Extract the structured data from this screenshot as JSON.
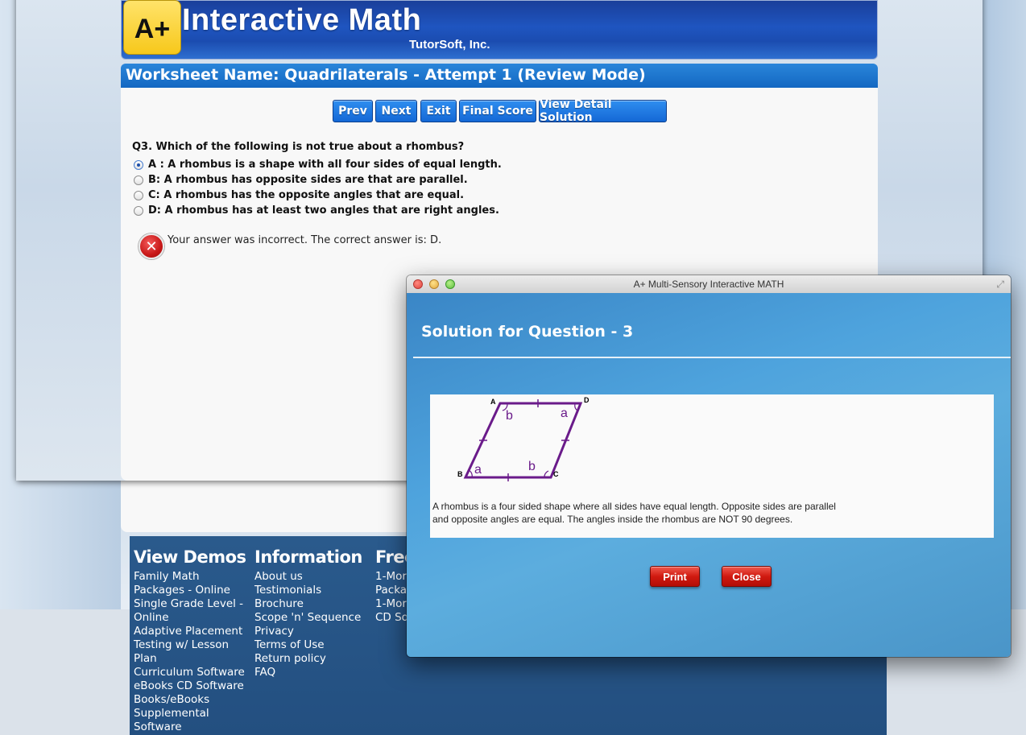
{
  "header": {
    "logo_text": "A+",
    "site_title": "Interactive Math",
    "company": "TutorSoft, Inc."
  },
  "worksheet": {
    "title": "Worksheet Name: Quadrilaterals - Attempt 1 (Review Mode)"
  },
  "nav_buttons": {
    "prev": "Prev",
    "next": "Next",
    "exit": "Exit",
    "final_score": "Final Score",
    "view_detail": "View Detail Solution"
  },
  "question": {
    "text": "Q3.  Which of the following is not true about a rhombus?",
    "options": [
      {
        "label": "A :  A rhombus is a shape with all four sides of equal length.",
        "selected": true
      },
      {
        "label": "B:  A rhombus has opposite sides are that are parallel.",
        "selected": false
      },
      {
        "label": "C:  A rhombus has the opposite angles that are equal.",
        "selected": false
      },
      {
        "label": "D:  A rhombus has at least two angles that are right angles.",
        "selected": false
      }
    ],
    "feedback": "Your answer was  incorrect.  The correct answer is: D."
  },
  "footer": {
    "columns": [
      {
        "heading": "View Demos",
        "links": [
          "Family Math",
          "Packages - Online",
          "Single Grade Level -",
          "Online",
          "Adaptive Placement",
          "Testing w/ Lesson",
          "Plan",
          "Curriculum Software",
          "eBooks CD Software",
          "Books/eBooks",
          "Supplemental",
          "Software"
        ]
      },
      {
        "heading": "Information",
        "links": [
          "About us",
          "Testimonials",
          "Brochure",
          "Scope 'n' Sequence",
          "Privacy",
          "Terms of Use",
          "Return policy",
          "FAQ"
        ]
      },
      {
        "heading": "Free",
        "links": [
          "1-Mor",
          "Packa",
          "1-Mor",
          "CD So"
        ]
      }
    ]
  },
  "dialog": {
    "window_title": "A+ Multi-Sensory Interactive MATH",
    "heading": "Solution for Question - 3",
    "diagram_labels": {
      "A": "A",
      "B": "B",
      "C": "C",
      "D": "D",
      "angle_a": "a",
      "angle_b": "b"
    },
    "solution_line1": "A rhombus is a four sided shape where  all sides have equal length.  Opposite sides are parallel",
    "solution_line2": "and opposite angles are equal.  The  angles inside the rhombus are NOT 90 degrees.",
    "print_label": "Print",
    "close_label": "Close"
  },
  "colors": {
    "header_blue": "#1f55c0",
    "button_blue": "#1468d6",
    "footer_blue": "#234f80",
    "dialog_blue": "#4ea3dd",
    "button_red": "#d01a10",
    "rhombus_purple": "#6a1b8a"
  }
}
